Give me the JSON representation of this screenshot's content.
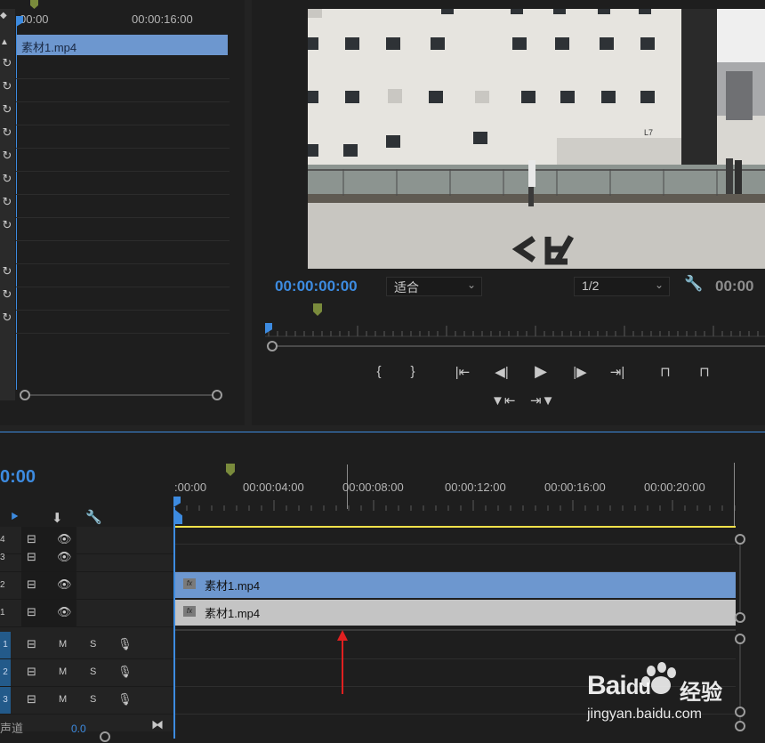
{
  "source": {
    "timecodes": [
      "00:00",
      "00:00:16:00"
    ],
    "clip_label": "素材1.mp4",
    "lock_rows": 12
  },
  "program": {
    "timecode": "00:00:00:00",
    "fit_dropdown": "适合",
    "resolution_dropdown": "1/2",
    "timecode_right": "00:00",
    "video_sign_text": "L7"
  },
  "controls": {
    "row1": [
      "{",
      "}",
      "|←",
      "◀|",
      "▶",
      "|▶",
      "→|",
      "insert",
      "overwrite"
    ],
    "row2": [
      "lift",
      "extract"
    ]
  },
  "timeline": {
    "timecode": "0:00",
    "ticks": [
      ":00:00",
      "00:00:04:00",
      "00:00:08:00",
      "00:00:12:00",
      "00:00:16:00",
      "00:00:20:00"
    ],
    "video_tracks": [
      "4",
      "3",
      "2",
      "1"
    ],
    "audio_tracks": [
      "1",
      "2",
      "3"
    ],
    "audio_buttons": {
      "m": "M",
      "s": "S"
    },
    "clip_v2_label": "素材1.mp4",
    "clip_v1_label": "素材1.mp4",
    "master_label": "声道",
    "master_value": "0.0"
  },
  "watermark": {
    "brand": "Bai",
    "brand2": "du",
    "brand_cn": "经验",
    "url": "jingyan.baidu.com"
  },
  "colors": {
    "accent_blue": "#3d8be0",
    "clip_blue": "#6d97cf",
    "clip_gray": "#c4c4c4",
    "work_area_yellow": "#f4e24a",
    "marker_green": "#7a8b3c",
    "annotation_arrow": "#e02020"
  }
}
